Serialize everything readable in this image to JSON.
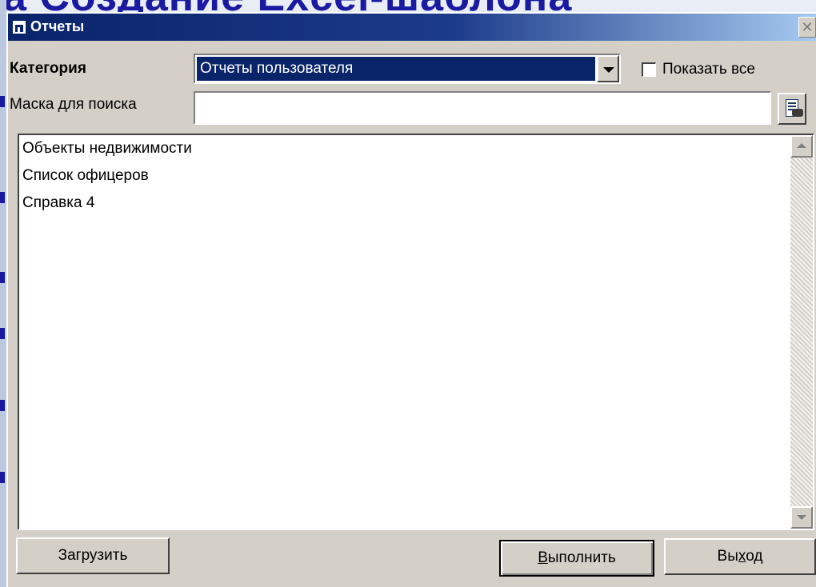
{
  "background": {
    "slide_title": "a Создание Excel-шаблона"
  },
  "window": {
    "title": "Отчеты",
    "close_glyph": "✕"
  },
  "category": {
    "label": "Категория",
    "selected": "Отчеты пользователя"
  },
  "show_all": {
    "label": "Показать все",
    "checked": false
  },
  "search": {
    "label": "Маска для поиска",
    "value": ""
  },
  "reports": {
    "items": [
      "Объекты недвижимости",
      "Список офицеров",
      "Справка 4"
    ]
  },
  "buttons": {
    "load": "Загрузить",
    "run_prefix": "",
    "run_mnemonic": "В",
    "run_rest": "ыполнить",
    "exit_prefix": "Вы",
    "exit_mnemonic": "х",
    "exit_rest": "од"
  },
  "icons": {
    "app": "window-icon",
    "find": "binoculars-document-icon",
    "dropdown": "chevron-down-icon"
  }
}
